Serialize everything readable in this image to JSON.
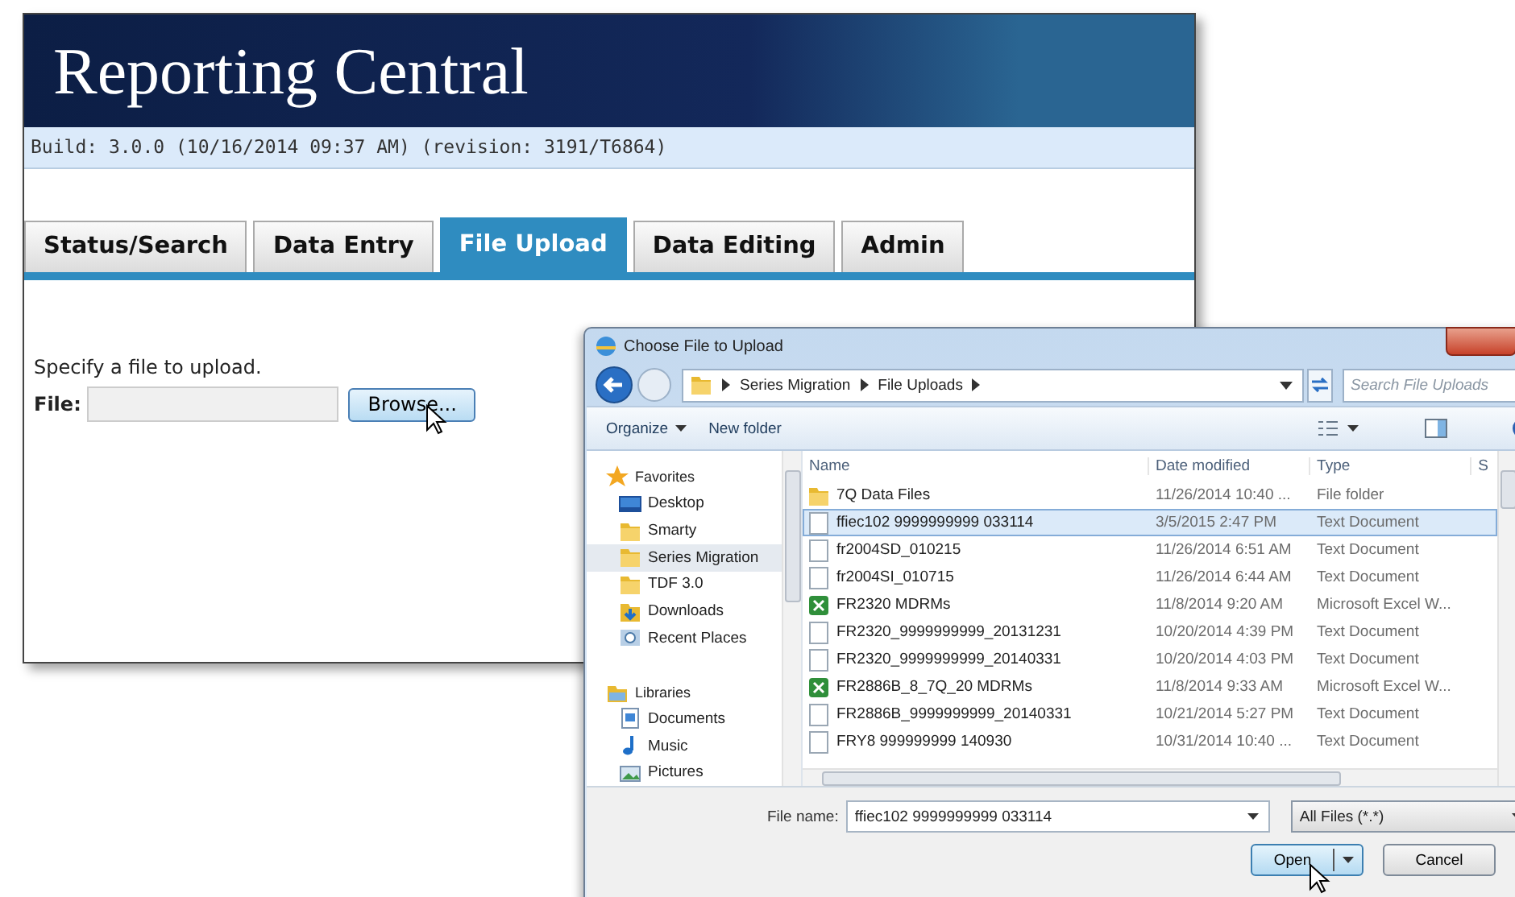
{
  "app": {
    "title": "Reporting Central",
    "build": "Build: 3.0.0 (10/16/2014 09:37 AM) (revision: 3191/T6864)",
    "tabs": [
      {
        "label": "Status/Search",
        "selected": false
      },
      {
        "label": "Data Entry",
        "selected": false
      },
      {
        "label": "File Upload",
        "selected": true
      },
      {
        "label": "Data Editing",
        "selected": false
      },
      {
        "label": "Admin",
        "selected": false
      }
    ],
    "prompt": "Specify a file to upload.",
    "file_label": "File:",
    "browse_button": "Browse..."
  },
  "dialog": {
    "title": "Choose File to Upload",
    "breadcrumb": [
      "Series Migration",
      "File Uploads"
    ],
    "search_placeholder": "Search File Uploads",
    "toolbar": {
      "organize": "Organize",
      "new_folder": "New folder"
    },
    "nav": [
      {
        "label": "Favorites",
        "kind": "section",
        "selected": false
      },
      {
        "label": "Desktop",
        "kind": "item",
        "selected": false
      },
      {
        "label": "Smarty",
        "kind": "item",
        "selected": false
      },
      {
        "label": "Series Migration",
        "kind": "item",
        "selected": true
      },
      {
        "label": "TDF 3.0",
        "kind": "item",
        "selected": false
      },
      {
        "label": "Downloads",
        "kind": "item",
        "selected": false
      },
      {
        "label": "Recent Places",
        "kind": "item",
        "selected": false
      },
      {
        "label": "Libraries",
        "kind": "section",
        "selected": false
      },
      {
        "label": "Documents",
        "kind": "item",
        "selected": false
      },
      {
        "label": "Music",
        "kind": "item",
        "selected": false
      },
      {
        "label": "Pictures",
        "kind": "item",
        "selected": false
      }
    ],
    "columns": [
      "Name",
      "Date modified",
      "Type",
      "S"
    ],
    "files": [
      {
        "name": "7Q Data Files",
        "date": "11/26/2014 10:40 ...",
        "type": "File folder",
        "kind": "folder",
        "selected": false
      },
      {
        "name": "ffiec102 9999999999 033114",
        "date": "3/5/2015 2:47 PM",
        "type": "Text Document",
        "kind": "text",
        "selected": true
      },
      {
        "name": "fr2004SD_010215",
        "date": "11/26/2014 6:51 AM",
        "type": "Text Document",
        "kind": "text",
        "selected": false
      },
      {
        "name": "fr2004SI_010715",
        "date": "11/26/2014 6:44 AM",
        "type": "Text Document",
        "kind": "text",
        "selected": false
      },
      {
        "name": "FR2320 MDRMs",
        "date": "11/8/2014 9:20 AM",
        "type": "Microsoft Excel W...",
        "kind": "excel",
        "selected": false
      },
      {
        "name": "FR2320_9999999999_20131231",
        "date": "10/20/2014 4:39 PM",
        "type": "Text Document",
        "kind": "text",
        "selected": false
      },
      {
        "name": "FR2320_9999999999_20140331",
        "date": "10/20/2014 4:03 PM",
        "type": "Text Document",
        "kind": "text",
        "selected": false
      },
      {
        "name": "FR2886B_8_7Q_20 MDRMs",
        "date": "11/8/2014 9:33 AM",
        "type": "Microsoft Excel W...",
        "kind": "excel",
        "selected": false
      },
      {
        "name": "FR2886B_9999999999_20140331",
        "date": "10/21/2014 5:27 PM",
        "type": "Text Document",
        "kind": "text",
        "selected": false
      },
      {
        "name": "FRY8 999999999 140930",
        "date": "10/31/2014 10:40 ...",
        "type": "Text Document",
        "kind": "text",
        "selected": false
      }
    ],
    "file_name_label": "File name:",
    "file_name_value": "ffiec102 9999999999 033114",
    "file_type": "All Files (*.*)",
    "buttons": [
      "Open",
      "Cancel"
    ]
  }
}
